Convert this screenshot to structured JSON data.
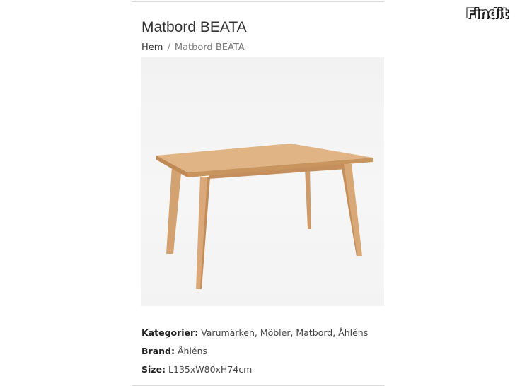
{
  "brand": {
    "logo_text": "Findit"
  },
  "product": {
    "title": "Matbord BEATA"
  },
  "breadcrumb": {
    "home": "Hem",
    "separator": "/",
    "current": "Matbord BEATA"
  },
  "image": {
    "subject": "dining-table-icon"
  },
  "details": {
    "categories_label": "Kategorier:",
    "categories_value": "Varumärken, Möbler, Matbord, Åhléns",
    "brand_label": "Brand:",
    "brand_value": "Åhléns",
    "size_label": "Size:",
    "size_value": "L135xW80xH74cm"
  },
  "colors": {
    "wood": "#d9a877",
    "wood_dark": "#c48f5c",
    "background": "#f4f4f4"
  }
}
